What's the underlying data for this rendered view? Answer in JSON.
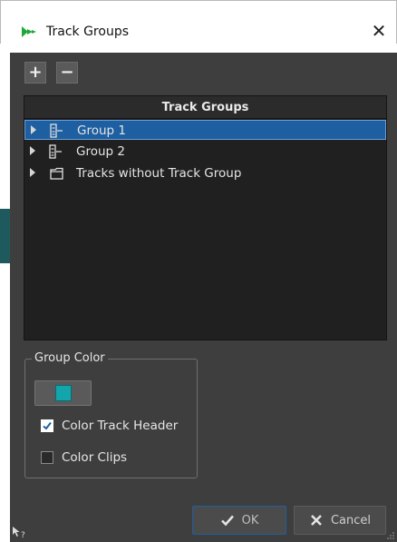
{
  "window": {
    "title": "Track Groups",
    "close_label": "✕"
  },
  "toolbar": {
    "add_label": "+",
    "remove_label": "−"
  },
  "tree": {
    "header": "Track Groups",
    "rows": [
      {
        "label": "Group 1",
        "icon": "track-group-icon",
        "selected": true
      },
      {
        "label": "Group 2",
        "icon": "track-group-icon",
        "selected": false
      },
      {
        "label": "Tracks without Track Group",
        "icon": "folder-icon",
        "selected": false
      }
    ]
  },
  "group_color": {
    "legend": "Group Color",
    "swatch_color": "#13a4ac",
    "options": [
      {
        "label": "Color Track Header",
        "checked": true
      },
      {
        "label": "Color Clips",
        "checked": false
      }
    ]
  },
  "buttons": {
    "ok_label": "OK",
    "cancel_label": "Cancel"
  },
  "colors": {
    "panel_bg": "#3e3e3e",
    "tree_bg": "#202020",
    "selection": "#1d5fa0",
    "accent": "#13a4ac"
  },
  "icons": {
    "app": "wavelab-app-icon",
    "help": "help-pointer-icon"
  }
}
